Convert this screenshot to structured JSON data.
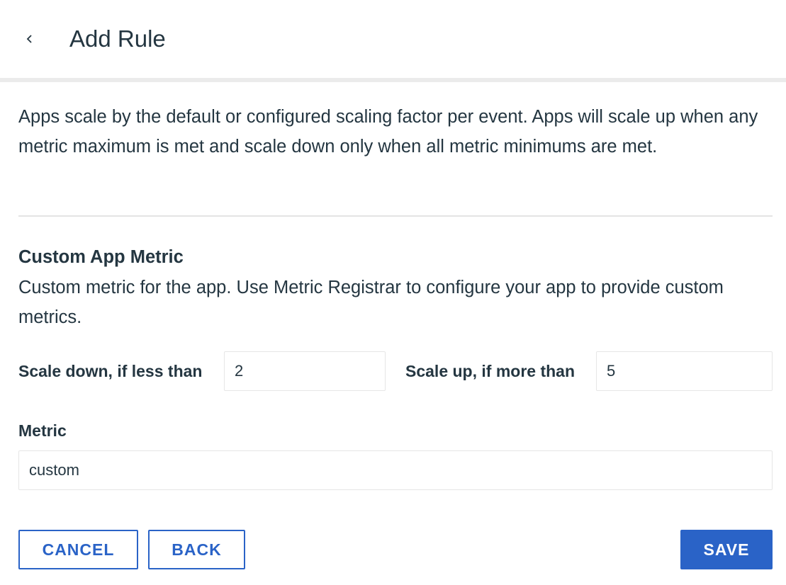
{
  "header": {
    "back_icon": "chevron-left-icon",
    "title": "Add Rule"
  },
  "description": "Apps scale by the default or configured scaling factor per event. Apps will scale up when any metric maximum is met and scale down only when all metric minimums are met.",
  "section": {
    "title": "Custom App Metric",
    "description": "Custom metric for the app. Use Metric Registrar to configure your app to provide custom metrics."
  },
  "form": {
    "scale_down_label": "Scale down, if less than",
    "scale_down_value": "2",
    "scale_up_label": "Scale up, if more than",
    "scale_up_value": "5",
    "metric_label": "Metric",
    "metric_value": "custom"
  },
  "actions": {
    "cancel_label": "CANCEL",
    "back_label": "BACK",
    "save_label": "SAVE"
  },
  "colors": {
    "accent": "#2a63c7",
    "text": "#243641",
    "divider": "#ebebeb"
  }
}
